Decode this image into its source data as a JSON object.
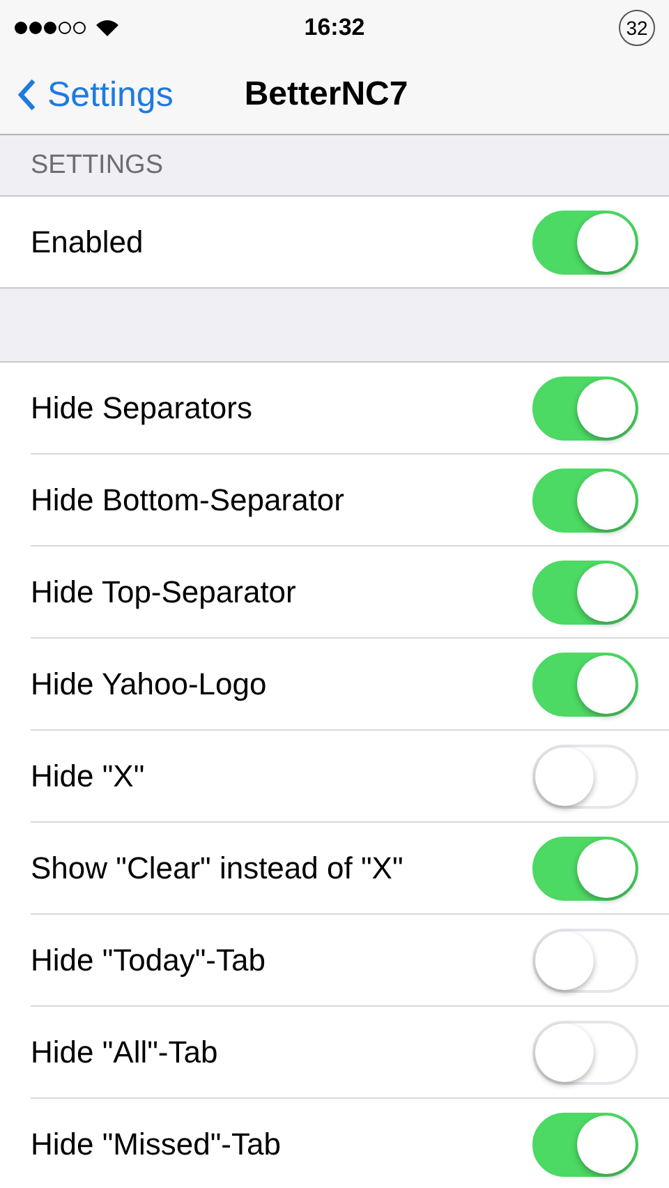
{
  "status_bar": {
    "time": "16:32",
    "battery": "32"
  },
  "nav": {
    "back": "Settings",
    "title": "BetterNC7"
  },
  "sections": [
    {
      "header": "SETTINGS",
      "rows": [
        {
          "label": "Enabled",
          "on": true
        }
      ]
    },
    {
      "rows": [
        {
          "label": "Hide Separators",
          "on": true
        },
        {
          "label": "Hide Bottom-Separator",
          "on": true
        },
        {
          "label": "Hide Top-Separator",
          "on": true
        },
        {
          "label": "Hide Yahoo-Logo",
          "on": true
        },
        {
          "label": "Hide \"X\"",
          "on": false
        },
        {
          "label": "Show \"Clear\" instead of \"X\"",
          "on": true
        },
        {
          "label": "Hide \"Today\"-Tab",
          "on": false
        },
        {
          "label": "Hide \"All\"-Tab",
          "on": false
        },
        {
          "label": "Hide \"Missed\"-Tab",
          "on": true
        }
      ]
    }
  ]
}
